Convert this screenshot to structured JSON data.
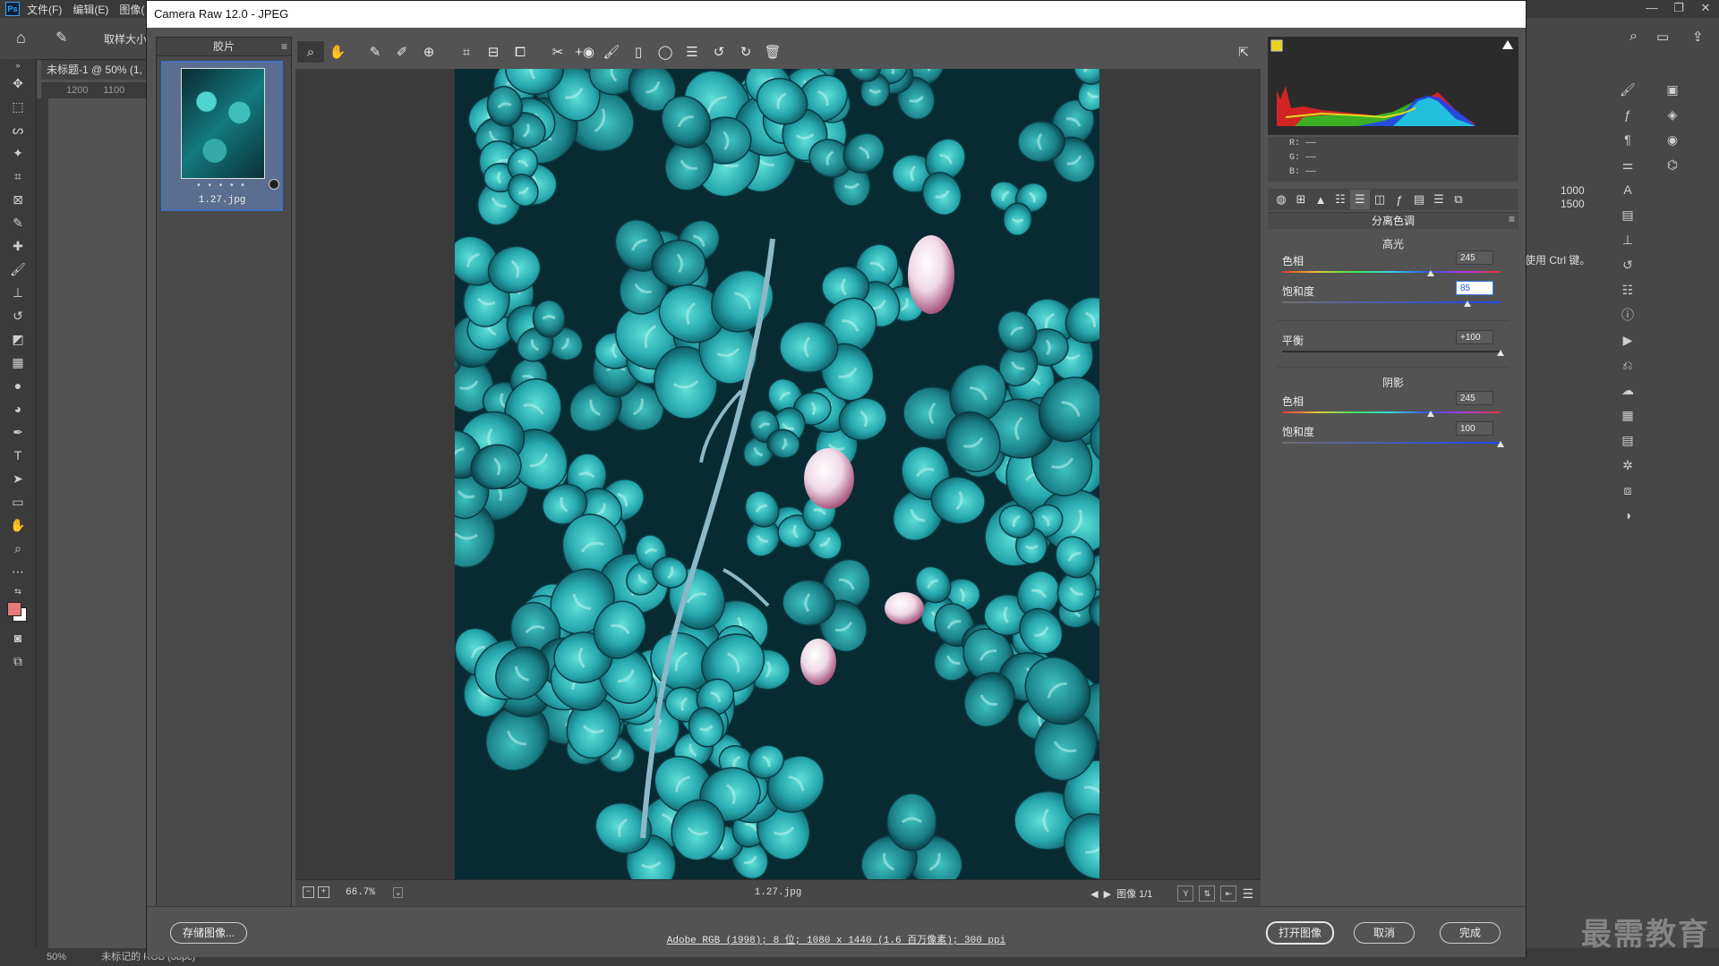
{
  "ps": {
    "logo": "Ps",
    "menus": [
      "文件(F)",
      "编辑(E)",
      "图像("
    ],
    "window_controls": [
      "—",
      "❐",
      "✕"
    ],
    "options_label": "取样大小",
    "doc_tab": "未标题-1 @ 50% (1,",
    "ruler_marks": [
      "1200",
      "1100"
    ],
    "right_numbers": [
      "1000",
      "1500"
    ],
    "right_hint": "使用 Ctrl 键。",
    "status_zoom": "50%",
    "status_text": "未标记的 RGB (8bpc)",
    "watermark": "最需教育"
  },
  "cr": {
    "title": "Camera Raw 12.0 -  JPEG",
    "filmstrip": {
      "title": "胶片",
      "dots": "• • • • •",
      "file_label": "1.27.jpg"
    },
    "preview": {
      "zoom": "66.7%",
      "filename": "1.27.jpg",
      "image_counter": "图像 1/1"
    },
    "rgb": {
      "r": "R:  ——",
      "g": "G:  ——",
      "b": "B:  ——"
    },
    "panel": {
      "title": "分离色调",
      "highlights_title": "高光",
      "shadows_title": "阴影",
      "sliders": [
        {
          "id": "hl-hue",
          "label": "色相",
          "value": "245",
          "pos": 0.68,
          "track": "hue"
        },
        {
          "id": "hl-sat",
          "label": "饱和度",
          "value": "85",
          "pos": 0.85,
          "track": "sat-hi",
          "focused": true
        },
        {
          "id": "balance",
          "label": "平衡",
          "value": "+100",
          "pos": 1.0,
          "track": "gray"
        },
        {
          "id": "sh-hue",
          "label": "色相",
          "value": "245",
          "pos": 0.68,
          "track": "hue"
        },
        {
          "id": "sh-sat",
          "label": "饱和度",
          "value": "100",
          "pos": 1.0,
          "track": "sat-sh"
        }
      ]
    },
    "footer": {
      "save_label": "存储图像...",
      "workflow": "Adobe RGB (1998); 8 位; 1080 x 1440 (1.6 百万像素); 300 ppi",
      "open_label": "打开图像",
      "cancel_label": "取消",
      "done_label": "完成"
    }
  },
  "colors": {
    "accent": "#3f6fc2",
    "photo_teal": "#2fb3b6",
    "blossom": "#f0d8e6"
  }
}
